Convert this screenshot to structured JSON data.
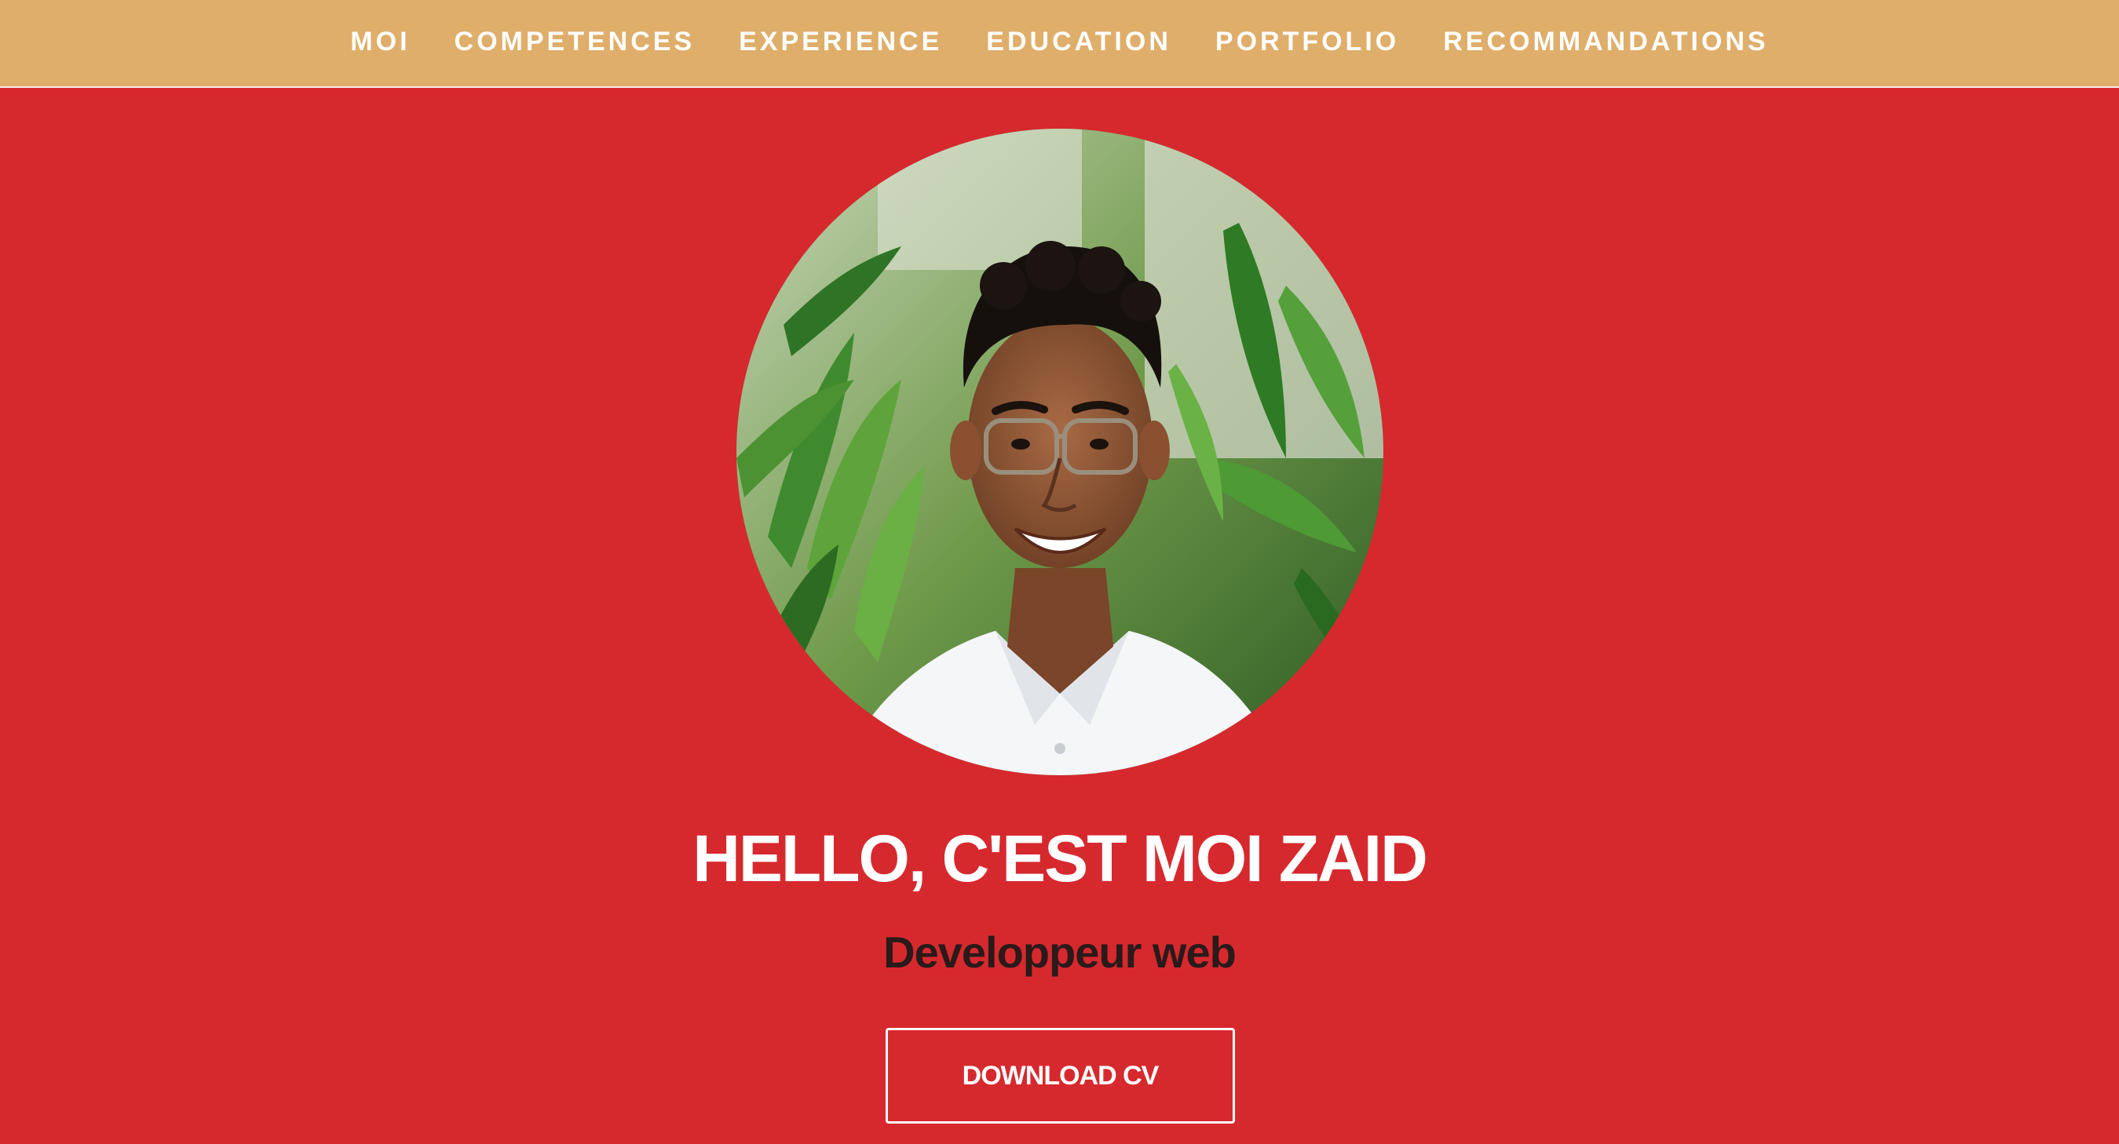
{
  "colors": {
    "navbar_bg": "#dfae6a",
    "hero_bg": "#d6292e",
    "title_text": "#ffffff",
    "subtitle_text": "#2a1a1a",
    "button_border": "#ffffff"
  },
  "nav": {
    "items": [
      {
        "label": "MOI"
      },
      {
        "label": "COMPETENCES"
      },
      {
        "label": "EXPERIENCE"
      },
      {
        "label": "EDUCATION"
      },
      {
        "label": "PORTFOLIO"
      },
      {
        "label": "RECOMMANDATIONS"
      }
    ]
  },
  "hero": {
    "avatar_icon": "profile-photo",
    "title": "HELLO, C'EST MOI ZAID",
    "subtitle": "Developpeur web",
    "cta_label": "DOWNLOAD CV"
  }
}
